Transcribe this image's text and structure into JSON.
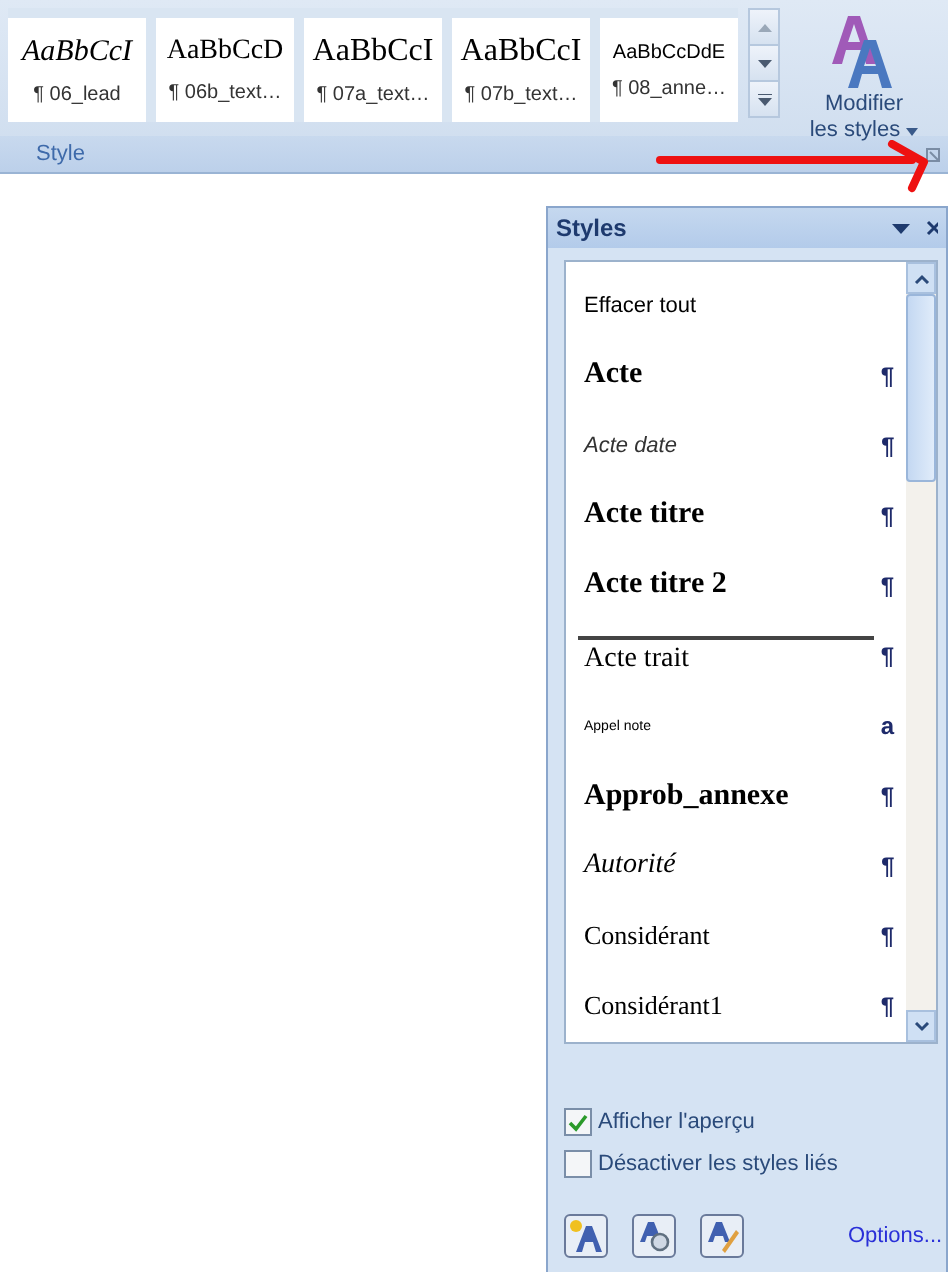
{
  "ribbon": {
    "gallery": [
      {
        "preview": "AaBbCcI",
        "label": "¶ 06_lead",
        "kind": "italic-serif"
      },
      {
        "preview": "AaBbCcD",
        "label": "¶ 06b_text…",
        "kind": "serif"
      },
      {
        "preview": "AaBbCcI",
        "label": "¶ 07a_text…",
        "kind": "serif-large"
      },
      {
        "preview": "AaBbCcI",
        "label": "¶ 07b_text…",
        "kind": "serif-large"
      },
      {
        "preview": "AaBbCcDdE",
        "label": "¶ 08_anne…",
        "kind": "sans-small"
      }
    ],
    "change_styles": {
      "line1": "Modifier",
      "line2": "les styles"
    },
    "group_label": "Style"
  },
  "styles_pane": {
    "title": "Styles",
    "items": [
      {
        "name": "Effacer tout",
        "kind": "clear"
      },
      {
        "name": "Acte",
        "mark": "¶",
        "kind": "bold-large"
      },
      {
        "name": "Acte date",
        "mark": "¶",
        "kind": "italic-sans"
      },
      {
        "name": "Acte titre",
        "mark": "¶",
        "kind": "bold-large"
      },
      {
        "name": "Acte titre 2",
        "mark": "¶",
        "kind": "bold-large"
      },
      {
        "name": "Acte trait",
        "mark": "¶",
        "kind": "rule"
      },
      {
        "name": "Appel note",
        "mark": "a",
        "kind": "tiny"
      },
      {
        "name": "Approb_annexe",
        "mark": "¶",
        "kind": "bold-large"
      },
      {
        "name": "Autorité",
        "mark": "¶",
        "kind": "italic-serif"
      },
      {
        "name": "Considérant",
        "mark": "¶",
        "kind": "serif"
      },
      {
        "name": "Considérant1",
        "mark": "¶",
        "kind": "serif"
      }
    ],
    "options": [
      {
        "label": "Afficher l'aperçu",
        "checked": true
      },
      {
        "label": "Désactiver les styles liés",
        "checked": false
      }
    ],
    "options_link": "Options..."
  }
}
